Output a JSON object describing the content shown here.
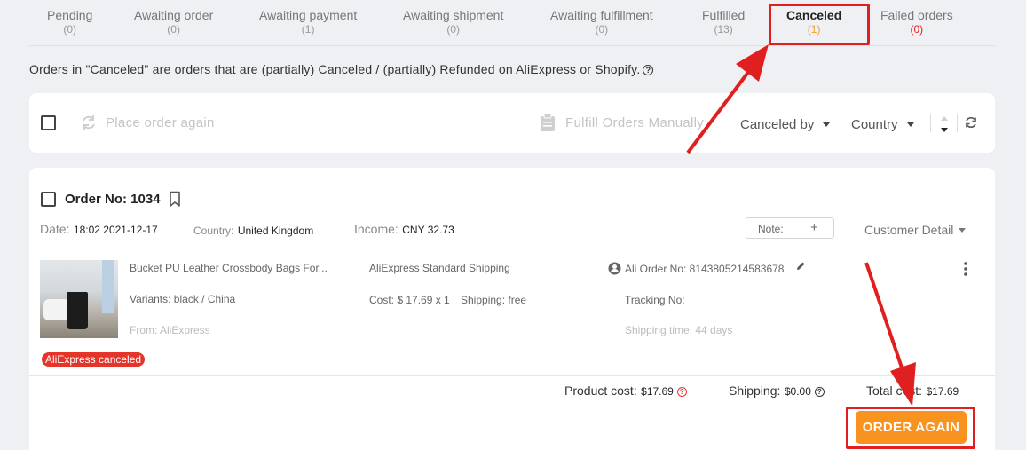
{
  "tabs": [
    {
      "label": "Pending",
      "count": "(0)"
    },
    {
      "label": "Awaiting order",
      "count": "(0)"
    },
    {
      "label": "Awaiting payment",
      "count": "(1)"
    },
    {
      "label": "Awaiting shipment",
      "count": "(0)"
    },
    {
      "label": "Awaiting fulfillment",
      "count": "(0)"
    },
    {
      "label": "Fulfilled",
      "count": "(13)"
    },
    {
      "label": "Canceled",
      "count": "(1)"
    },
    {
      "label": "Failed orders",
      "count": "(0)"
    }
  ],
  "notice": "Orders in \"Canceled\" are orders that are (partially) Canceled / (partially) Refunded on AliExpress or Shopify.",
  "toolbar": {
    "place_again": "Place order again",
    "fulfill": "Fulfill Orders Manually",
    "canceled_by": "Canceled by",
    "country": "Country"
  },
  "order": {
    "number": "Order No: 1034",
    "date_label": "Date:",
    "date": "18:02 2021-12-17",
    "country_label": "Country:",
    "country": "United Kingdom",
    "income_label": "Income:",
    "income": "CNY 32.73",
    "note_label": "Note:",
    "note_add": "+",
    "customer_detail": "Customer Detail",
    "product": {
      "title": "Bucket PU Leather Crossbody Bags For...",
      "variants": "Variants: black / China",
      "from": "From: AliExpress",
      "shipping_method": "AliExpress Standard Shipping",
      "cost": "Cost: $ 17.69 x 1",
      "shipping": "Shipping: free",
      "ali_order": "Ali Order No: 8143805214583678",
      "tracking": "Tracking No:",
      "shipping_time": "Shipping time: 44 days",
      "status": "AliExpress canceled"
    },
    "totals": {
      "product_cost_label": "Product cost:",
      "product_cost": "$17.69",
      "shipping_label": "Shipping:",
      "shipping": "$0.00",
      "total_label": "Total cost:",
      "total": "$17.69"
    },
    "order_again": "ORDER AGAIN"
  },
  "colors": {
    "accent_orange": "#f7931e",
    "annotation_red": "#e02020",
    "badge_red": "#e5352b"
  }
}
